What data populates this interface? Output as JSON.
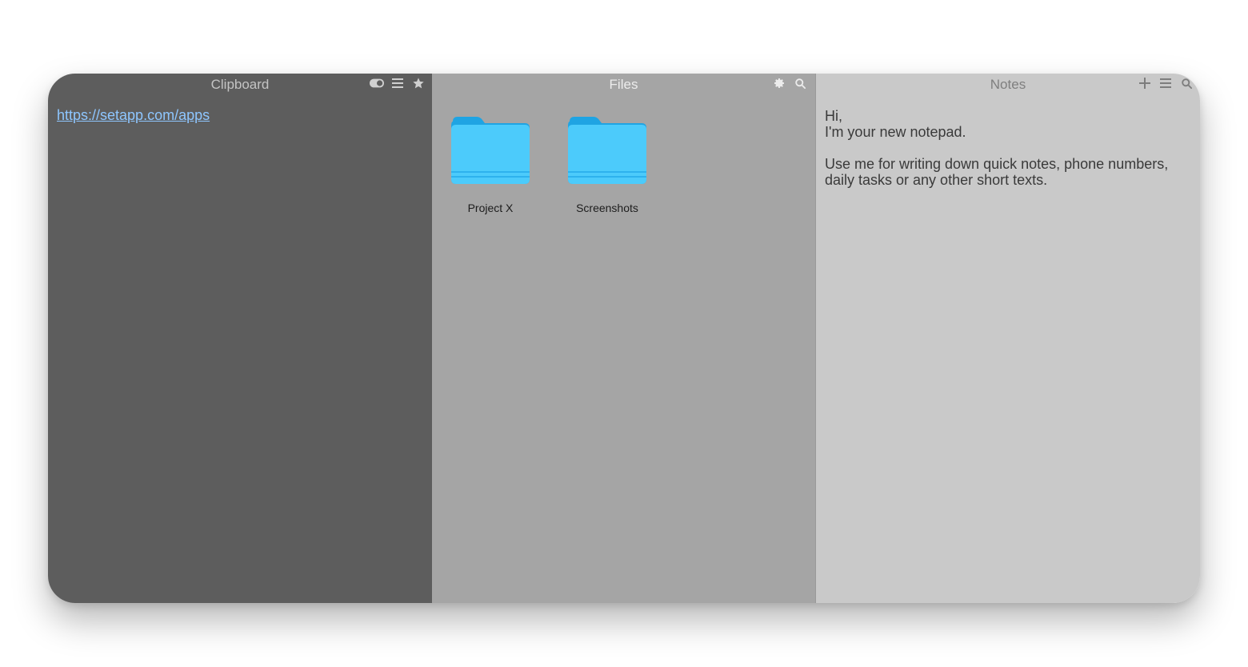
{
  "clipboard": {
    "title": "Clipboard",
    "items": [
      {
        "text": "https://setapp.com/apps"
      }
    ],
    "tools": [
      "toggle-icon",
      "menu-icon",
      "star-icon"
    ]
  },
  "files": {
    "title": "Files",
    "folders": [
      {
        "name": "Project X"
      },
      {
        "name": "Screenshots"
      }
    ],
    "tools": [
      "gear-icon",
      "search-icon"
    ]
  },
  "notes": {
    "title": "Notes",
    "lines": [
      "Hi,",
      "I'm your new notepad.",
      "",
      "Use me for writing down quick notes, phone numbers,",
      "daily tasks or any other short texts."
    ],
    "tools": [
      "plus-icon",
      "menu-icon",
      "search-icon"
    ]
  },
  "colors": {
    "clipboard_bg": "#5d5d5d",
    "files_bg": "#a5a5a5",
    "notes_bg": "#c9c9c9",
    "link": "#8ec6ff",
    "folder": "#42c6fb"
  }
}
